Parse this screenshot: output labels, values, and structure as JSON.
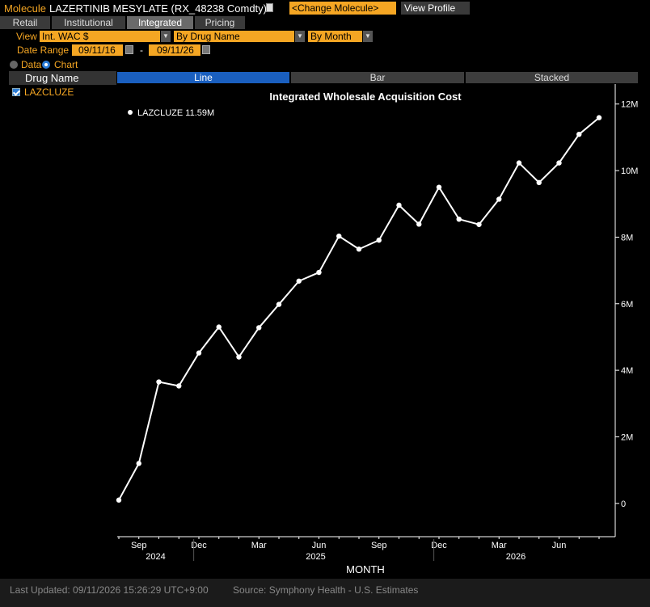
{
  "header": {
    "label": "Molecule",
    "name": "LAZERTINIB MESYLATE (RX_48238 Comdty)",
    "change_button": "<Change Molecule>",
    "profile_button": "View Profile"
  },
  "tabs": [
    "Retail",
    "Institutional",
    "Integrated",
    "Pricing"
  ],
  "active_tab": "Integrated",
  "controls": {
    "view_label": "View",
    "measure": "Int. WAC $",
    "group_by": "By Drug Name",
    "period": "By Month",
    "date_range_label": "Date Range",
    "start_date": "09/11/16",
    "end_date": "09/11/26",
    "date_dash": "-",
    "data_option": "Data",
    "chart_option": "Chart",
    "selected_option": "Chart"
  },
  "sidebar": {
    "header": "Drug Name",
    "items": [
      {
        "label": "LAZCLUZE",
        "checked": true
      }
    ]
  },
  "chart_tabs": [
    "Line",
    "Bar",
    "Stacked"
  ],
  "active_chart_tab": "Line",
  "legend": {
    "entry": "LAZCLUZE 11.59M"
  },
  "footer": {
    "last_updated": "Last Updated: 09/11/2026 15:26:29 UTC+9:00",
    "source": "Source: Symphony Health - U.S. Estimates"
  },
  "colors": {
    "accent": "#f5a623",
    "series": "#ffffff",
    "active_tab": "#1a5fbf"
  },
  "chart_data": {
    "type": "line",
    "title": "Integrated Wholesale Acquisition Cost",
    "xlabel": "MONTH",
    "ylabel": "",
    "ylim": [
      -1000000,
      12600000
    ],
    "yticks": [
      0,
      2000000,
      4000000,
      6000000,
      8000000,
      10000000,
      12000000
    ],
    "ytick_labels": [
      "0",
      "2M",
      "4M",
      "6M",
      "8M",
      "10M",
      "12M"
    ],
    "x": [
      "2024-08",
      "2024-09",
      "2024-10",
      "2024-11",
      "2024-12",
      "2025-01",
      "2025-02",
      "2025-03",
      "2025-04",
      "2025-05",
      "2025-06",
      "2025-07",
      "2025-08",
      "2025-09",
      "2025-10",
      "2025-11",
      "2025-12",
      "2026-01",
      "2026-02",
      "2026-03",
      "2026-04",
      "2026-05",
      "2026-06",
      "2026-07",
      "2026-08"
    ],
    "series": [
      {
        "name": "LAZCLUZE",
        "values": [
          100000,
          1200000,
          3650000,
          3530000,
          4520000,
          5300000,
          4400000,
          5280000,
          5980000,
          6680000,
          6940000,
          8030000,
          7640000,
          7910000,
          8960000,
          8390000,
          9500000,
          8540000,
          8380000,
          9140000,
          10230000,
          9640000,
          10230000,
          11090000,
          11590000
        ]
      }
    ],
    "month_ticks": [
      {
        "index": 1,
        "label": "Sep"
      },
      {
        "index": 4,
        "label": "Dec"
      },
      {
        "index": 7,
        "label": "Mar"
      },
      {
        "index": 10,
        "label": "Jun"
      },
      {
        "index": 13,
        "label": "Sep"
      },
      {
        "index": 16,
        "label": "Dec"
      },
      {
        "index": 19,
        "label": "Mar"
      },
      {
        "index": 22,
        "label": "Jun"
      }
    ],
    "year_labels": [
      {
        "index": 2,
        "label": "2024"
      },
      {
        "index": 10,
        "label": "2025"
      },
      {
        "index": 20,
        "label": "2026"
      }
    ],
    "year_separators": [
      4,
      16
    ],
    "grid": false,
    "legend_position": "top-left"
  }
}
